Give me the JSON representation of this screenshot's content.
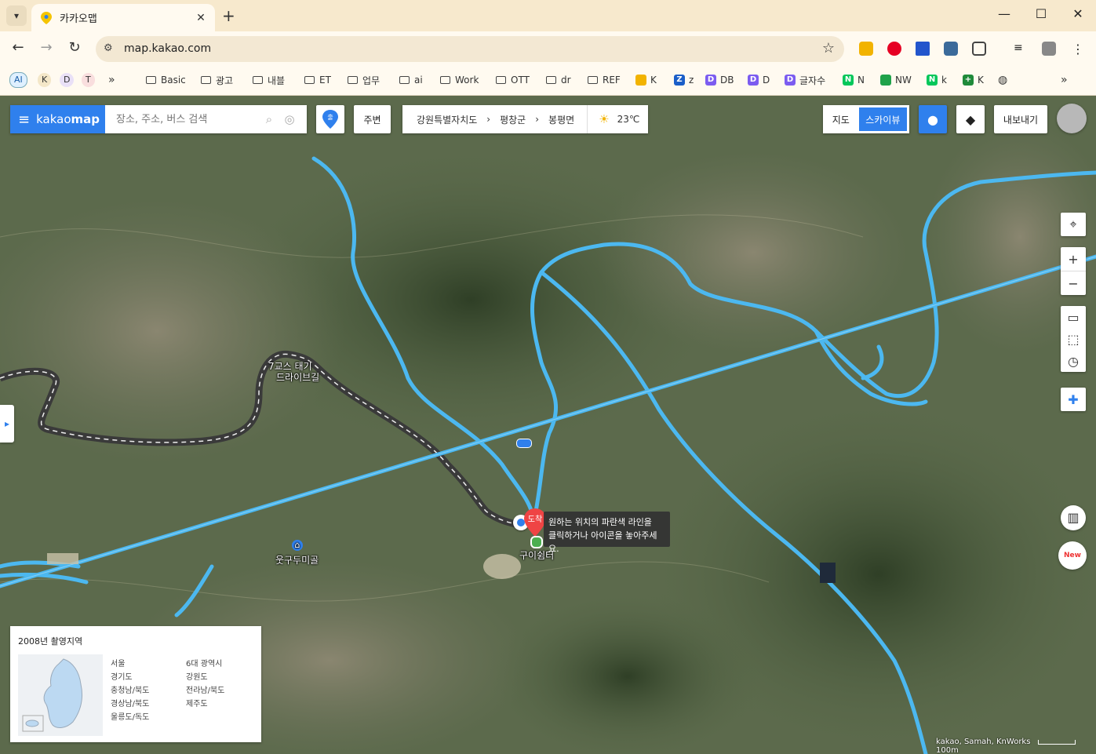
{
  "browser": {
    "tab_title": "카카오맵",
    "url": "map.kakao.com",
    "bookmarks": {
      "pills": [
        "AI",
        "K",
        "D",
        "T"
      ],
      "more": "»",
      "folders": [
        "Basic",
        "광고",
        "내블",
        "ET",
        "업무",
        "ai",
        "Work",
        "OTT",
        "dr",
        "REF"
      ],
      "sites": [
        "K",
        "z",
        "DB",
        "D",
        "글자수",
        "N",
        "NW",
        "k",
        "K"
      ],
      "overflow": "»"
    }
  },
  "map": {
    "brand_prefix": "kakao",
    "brand_suffix": "map",
    "search_placeholder": "장소, 주소, 버스 검색",
    "start_icon_label": "출",
    "nearby_button": "주변",
    "breadcrumb": [
      "강원특별자치도",
      "평창군",
      "봉평면"
    ],
    "weather": "23℃",
    "map_view": "지도",
    "skyview": "스카이뷰",
    "export_button": "내보내기",
    "place_labels": {
      "drive_route_1": "7교스 태기",
      "drive_route_2": "드라이브길",
      "village": "웃구두미골",
      "shelter": "구이쉼터"
    },
    "destination_badge": "도착",
    "tooltip_line1": "원하는 위치의 파란색 라인을",
    "tooltip_line2": "클릭하거나 아이콘을 놓아주세요.",
    "legend": {
      "title": "2008년 촬영지역",
      "col1": [
        "서울",
        "경기도",
        "충청남/북도",
        "경상남/북도",
        "울릉도/독도"
      ],
      "col2": [
        "6대 광역시",
        "강원도",
        "전라남/북도",
        "제주도"
      ]
    },
    "copyright": "kakao, Samah, KnWorks",
    "scale": "100m",
    "new_badge": "New"
  }
}
